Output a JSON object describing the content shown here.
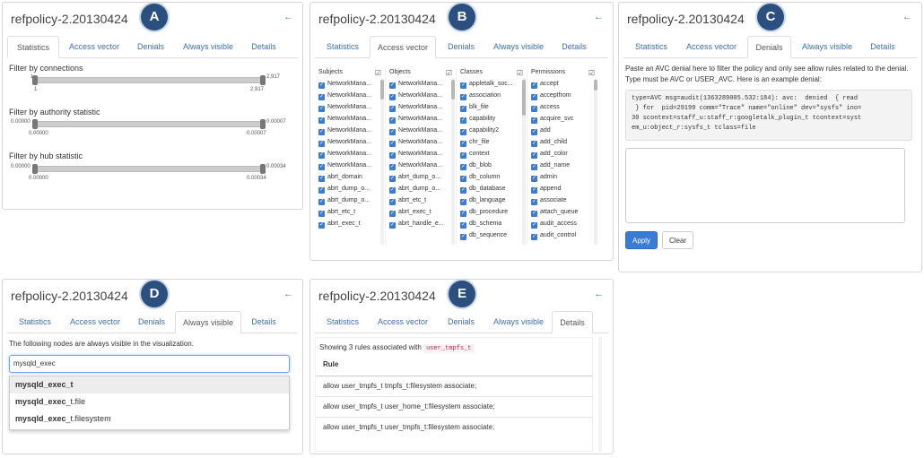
{
  "title": "refpolicy-2.20130424",
  "back_glyph": "←",
  "tab_labels": [
    "Statistics",
    "Access vector",
    "Denials",
    "Always visible",
    "Details"
  ],
  "badges": [
    "A",
    "B",
    "C",
    "D",
    "E"
  ],
  "statistics": {
    "connections": {
      "label": "Filter by connections",
      "left": "1",
      "right": "2,917",
      "left_val": "1",
      "right_val": "2,917"
    },
    "authority": {
      "label": "Filter by authority statistic",
      "left": "0.00000",
      "right": "0.00007",
      "left_val": "0.00000",
      "right_val": "0.00007"
    },
    "hub": {
      "label": "Filter by hub statistic",
      "left": "0.00000",
      "right": "0.00034",
      "left_val": "0.00000",
      "right_val": "0.00034"
    }
  },
  "access_vector": {
    "columns": [
      {
        "header": "Subjects",
        "items": [
          "NetworkMana...",
          "NetworkMana...",
          "NetworkMana...",
          "NetworkMana...",
          "NetworkMana...",
          "NetworkMana...",
          "NetworkMana...",
          "NetworkMana...",
          "abrt_domain",
          "abrt_dump_o...",
          "abrt_dump_o...",
          "abrt_etc_t",
          "abrt_exec_t"
        ]
      },
      {
        "header": "Objects",
        "items": [
          "NetworkMana...",
          "NetworkMana...",
          "NetworkMana...",
          "NetworkMana...",
          "NetworkMana...",
          "NetworkMana...",
          "NetworkMana...",
          "NetworkMana...",
          "abrt_dump_o...",
          "abrt_dump_o...",
          "abrt_etc_t",
          "abrt_exec_t",
          "abrt_handle_e..."
        ]
      },
      {
        "header": "Classes",
        "items": [
          "appletalk_soc...",
          "association",
          "blk_file",
          "capability",
          "capability2",
          "chr_file",
          "context",
          "db_blob",
          "db_column",
          "db_database",
          "db_language",
          "db_procedure",
          "db_schema",
          "db_sequence"
        ]
      },
      {
        "header": "Permissions",
        "items": [
          "accept",
          "acceptfrom",
          "access",
          "acquire_svc",
          "add",
          "add_child",
          "add_color",
          "add_name",
          "admin",
          "append",
          "associate",
          "attach_queue",
          "audit_access",
          "audit_control"
        ]
      }
    ]
  },
  "denials": {
    "instructions": "Paste an AVC denial here to filter the policy and only see allow rules related to the denial. Type must be AVC or USER_AVC. Here is an example denial:",
    "example_lines": [
      "type=AVC msg=audit(1363289005.532:184): avc:  denied  { read",
      " } for  pid=29199 comm=\"Trace\" name=\"online\" dev=\"sysfs\" ino=",
      "30 scontext=staff_u:staff_r:googletalk_plugin_t tcontext=syst",
      "em_u:object_r:sysfs_t tclass=file"
    ],
    "apply_label": "Apply",
    "clear_label": "Clear"
  },
  "always_visible": {
    "description": "The following nodes are always visible in the visualization.",
    "input_value": "mysqld_exec",
    "suggestions": [
      {
        "bold": "mysqld_exec",
        "rest": "_t"
      },
      {
        "bold": "mysqld_exec",
        "rest": "_t.file"
      },
      {
        "bold": "mysqld_exec",
        "rest": "_t.filesystem"
      }
    ]
  },
  "details": {
    "summary_prefix": "Showing 3 rules associated with",
    "summary_type": "user_tmpfs_t",
    "rule_header": "Rule",
    "rules": [
      "allow user_tmpfs_t tmpfs_t:filesystem associate;",
      "allow user_tmpfs_t user_home_t:filesystem associate;",
      "allow user_tmpfs_t user_tmpfs_t:filesystem associate;"
    ]
  },
  "colors": {
    "accent": "#3a7bd5",
    "badge": "#2b4f7e",
    "link": "#3a6fb5"
  }
}
